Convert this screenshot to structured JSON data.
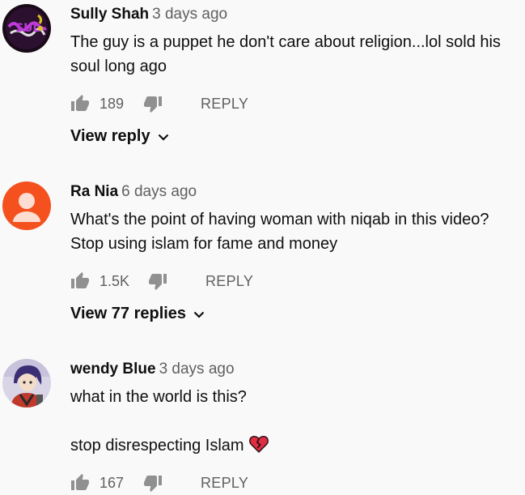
{
  "comments": [
    {
      "author": "Sully Shah",
      "time": "3 days ago",
      "lines": [
        "The guy is a puppet he don't care about religion...lol sold his soul long ago"
      ],
      "likes": "189",
      "reply_label": "REPLY",
      "view_replies": "View reply",
      "avatar": "graffiti-avatar"
    },
    {
      "author": "Ra Nia",
      "time": "6 days ago",
      "lines": [
        "What's the point of having woman with niqab in this video? Stop using islam for fame and money"
      ],
      "likes": "1.5K",
      "reply_label": "REPLY",
      "view_replies": "View 77 replies",
      "avatar": "default-person-avatar",
      "avatar_color": "#f4511e"
    },
    {
      "author": "wendy Blue",
      "time": "3 days ago",
      "lines": [
        "what in the world is this?",
        "stop disrespecting Islam"
      ],
      "likes": "167",
      "reply_label": "REPLY",
      "avatar": "anime-character-avatar",
      "emoji": "broken-heart-icon"
    }
  ],
  "icons": {
    "like": "thumb-up-icon",
    "dislike": "thumb-down-icon",
    "expand": "chevron-down-icon"
  }
}
